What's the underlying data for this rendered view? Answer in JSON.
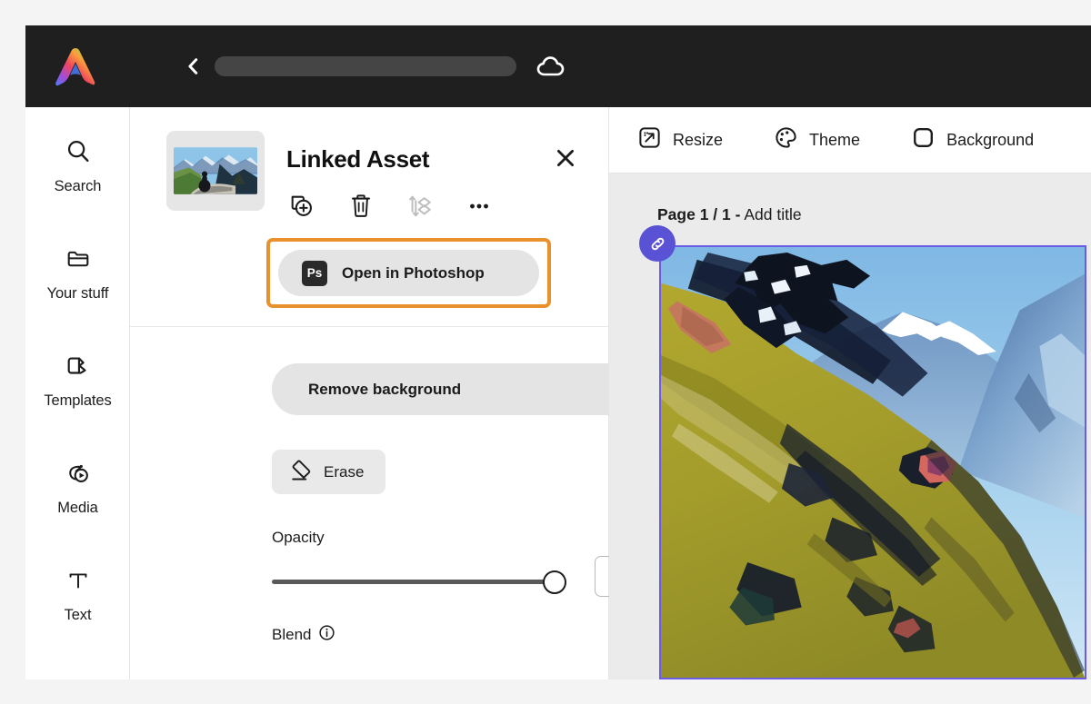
{
  "topbar": {
    "logo_name": "adobe-express-logo",
    "back_label": "Back",
    "doc_title_placeholder": "",
    "cloud_label": "Cloud sync"
  },
  "sidebar": {
    "items": [
      {
        "id": "search",
        "label": "Search",
        "icon": "search-icon"
      },
      {
        "id": "your-stuff",
        "label": "Your stuff",
        "icon": "folder-icon"
      },
      {
        "id": "templates",
        "label": "Templates",
        "icon": "templates-icon"
      },
      {
        "id": "media",
        "label": "Media",
        "icon": "media-icon"
      },
      {
        "id": "text",
        "label": "Text",
        "icon": "text-icon"
      }
    ]
  },
  "panel": {
    "title": "Linked Asset",
    "close_label": "✕",
    "actions": [
      {
        "id": "duplicate",
        "label": "Duplicate",
        "icon": "duplicate-icon",
        "disabled": false
      },
      {
        "id": "delete",
        "label": "Delete",
        "icon": "trash-icon",
        "disabled": false
      },
      {
        "id": "arrange",
        "label": "Arrange",
        "icon": "layer-order-icon",
        "disabled": true
      },
      {
        "id": "more",
        "label": "More",
        "icon": "more-icon",
        "disabled": false
      }
    ],
    "photoshop_button": {
      "label": "Open in Photoshop",
      "badge": "Ps",
      "highlighted": true,
      "highlight_color": "#e8912d"
    },
    "remove_background_label": "Remove background",
    "erase_label": "Erase",
    "opacity_label": "Opacity",
    "opacity_value": "100%",
    "opacity_percent": 100,
    "blend_label": "Blend",
    "blend_info_icon": "info-icon"
  },
  "canvas": {
    "tools": [
      {
        "id": "resize",
        "label": "Resize",
        "icon": "resize-icon"
      },
      {
        "id": "theme",
        "label": "Theme",
        "icon": "palette-icon"
      },
      {
        "id": "background",
        "label": "Background",
        "icon": "rounded-square-icon"
      }
    ],
    "page_prefix": "Page 1 / 1 -",
    "page_title": "Add title",
    "selection_color": "#6b5ce7",
    "link_badge_icon": "link-icon",
    "link_badge_color": "#5a52d5"
  }
}
